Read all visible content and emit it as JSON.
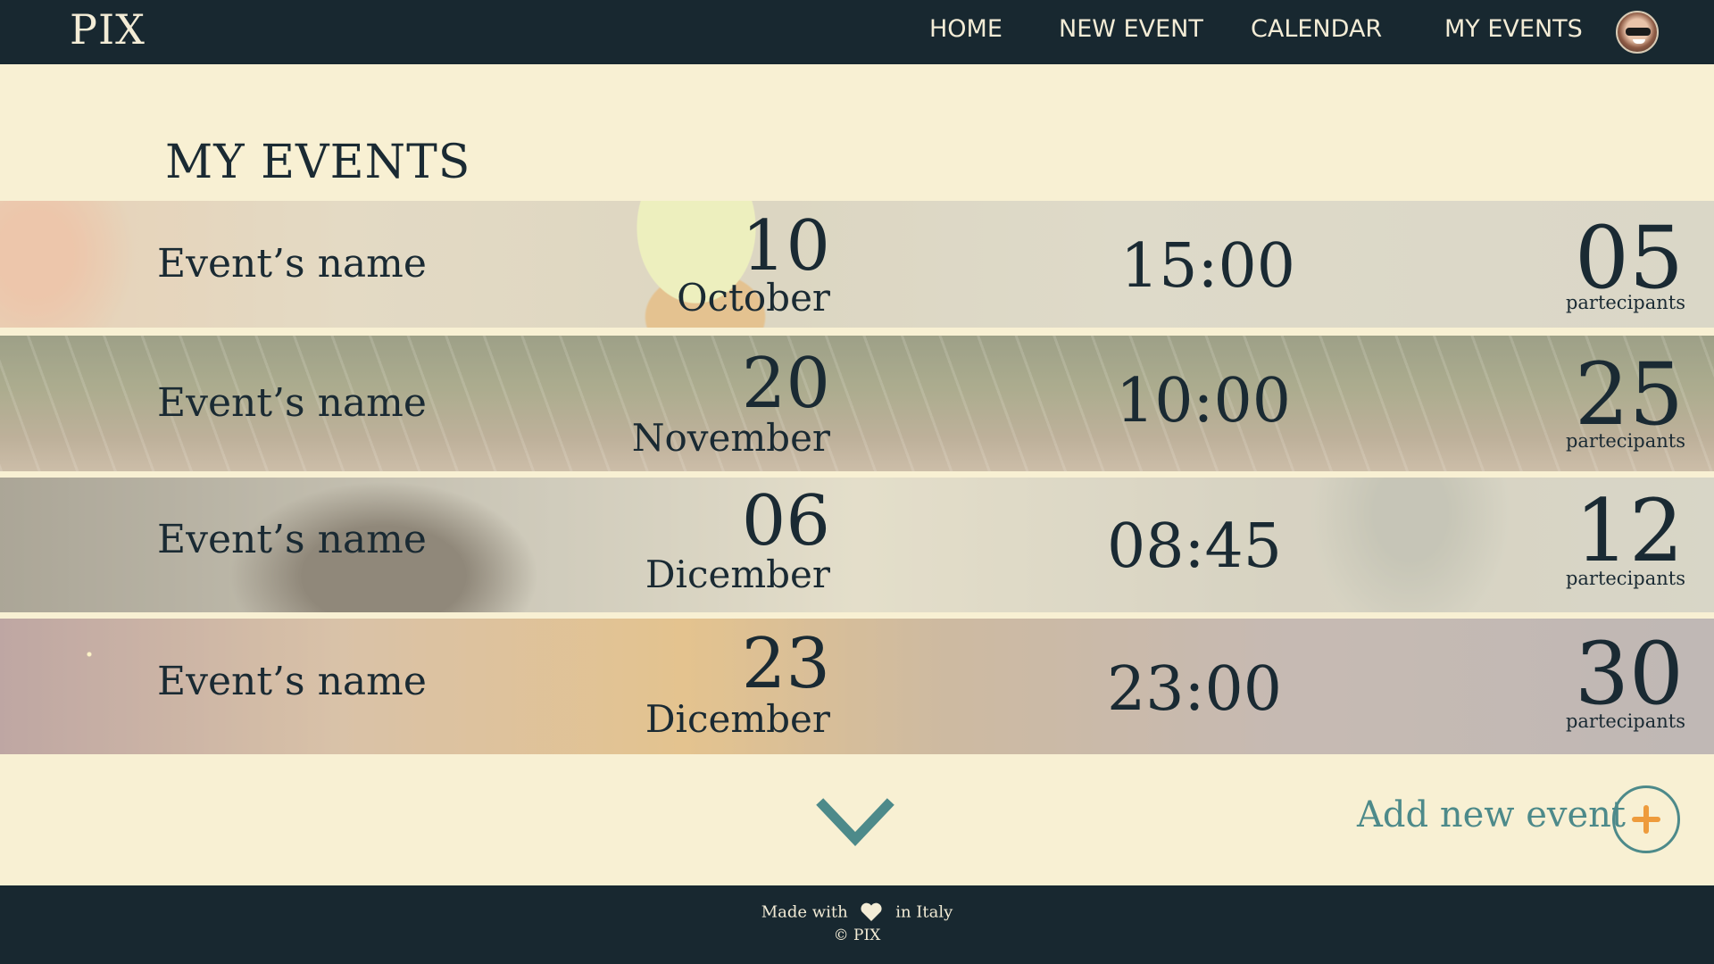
{
  "header": {
    "brand": "PIX",
    "nav": [
      "HOME",
      "NEW EVENT",
      "CALENDAR",
      "MY EVENTS"
    ]
  },
  "page": {
    "title": "MY EVENTS"
  },
  "events": [
    {
      "name": "Event’s name",
      "day": "10",
      "month": "October",
      "time": "15:00",
      "count": "05",
      "count_label": "partecipants"
    },
    {
      "name": "Event’s name",
      "day": "20",
      "month": "November",
      "time": "10:00",
      "count": "25",
      "count_label": "partecipants"
    },
    {
      "name": "Event’s name",
      "day": "06",
      "month": "Dicember",
      "time": "08:45",
      "count": "12",
      "count_label": "partecipants"
    },
    {
      "name": "Event’s name",
      "day": "23",
      "month": "Dicember",
      "time": "23:00",
      "count": "30",
      "count_label": "partecipants"
    }
  ],
  "actions": {
    "add_label": "Add new event"
  },
  "footer": {
    "made_with": "Made with",
    "in_italy": "in Italy",
    "copyright": "© PIX"
  },
  "colors": {
    "header_bg": "#182830",
    "page_bg": "#f8f0d3",
    "accent_teal": "#4d8a8a",
    "accent_orange": "#ee9b3c"
  }
}
